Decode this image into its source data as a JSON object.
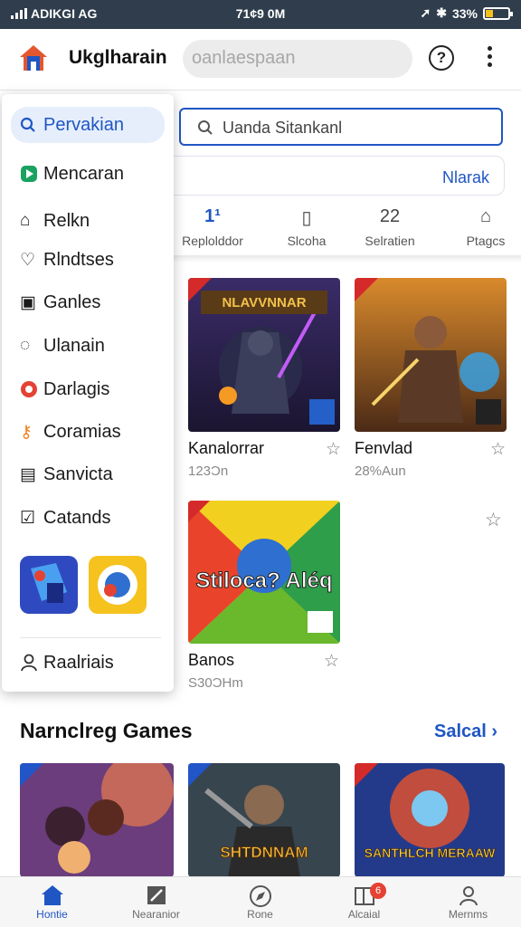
{
  "status_bar": {
    "carrier": "ADIKGI AG",
    "time": "71¢9 0M",
    "battery": "33%",
    "battery_level": 0.33
  },
  "app_bar": {
    "title": "Ukglharain",
    "search_placeholder": "oanlaespaan",
    "help_icon": "help-circle-icon",
    "more_icon": "more-vertical-icon"
  },
  "search": {
    "value": "Uanda Sitankanl"
  },
  "tabstrip": {
    "link": "Nlarak"
  },
  "categories": [
    {
      "label": "Replolddor",
      "icon": "1¹"
    },
    {
      "label": "Slcoha",
      "icon": "▯"
    },
    {
      "label": "Selratien",
      "icon": "22"
    },
    {
      "label": "Ptagcs",
      "icon": "⌂"
    }
  ],
  "games": [
    {
      "name": "Kanalorrar",
      "meta": "123Ɔn",
      "art_title": "NLAVVNNAR"
    },
    {
      "name": "Fenvlad",
      "meta": "28%Aun",
      "art_title": ""
    },
    {
      "name": "Banos",
      "meta": "S30ƆHm",
      "art_title": "Stiloca? Aléq"
    }
  ],
  "drawer": {
    "items": [
      {
        "label": "Pervakian",
        "icon": "search-icon"
      },
      {
        "label": "Mencaran",
        "icon": "play-store-icon"
      },
      {
        "label": "Relkn",
        "icon": "apps-icon"
      },
      {
        "label": "Rlndtses",
        "icon": "heart-icon"
      },
      {
        "label": "Ganles",
        "icon": "gamepad-icon"
      },
      {
        "label": "Ulanain",
        "icon": "chat-icon"
      },
      {
        "label": "Darlagis",
        "icon": "badge-icon"
      },
      {
        "label": "Coramias",
        "icon": "key-icon"
      },
      {
        "label": "Sanvicta",
        "icon": "document-icon"
      },
      {
        "label": "Catands",
        "icon": "checkbox-icon"
      }
    ],
    "footer_item": {
      "label": "Raalriais",
      "icon": "person-icon"
    }
  },
  "section": {
    "title": "Narnclreg Games",
    "link": "Salcal"
  },
  "bottom_tiles": [
    "",
    "SHTDNNAM",
    "SANTHLCH MERAAW"
  ],
  "bottom_nav": [
    {
      "label": "Hontie",
      "icon": "home-icon"
    },
    {
      "label": "Nearanior",
      "icon": "edit-icon"
    },
    {
      "label": "Rone",
      "icon": "compass-icon"
    },
    {
      "label": "Alcaial",
      "icon": "library-icon",
      "badge": "6"
    },
    {
      "label": "Mernms",
      "icon": "person-icon"
    }
  ],
  "colors": {
    "accent": "#1f56c4",
    "status_bar": "#2f3d4c",
    "badge": "#e44233"
  }
}
